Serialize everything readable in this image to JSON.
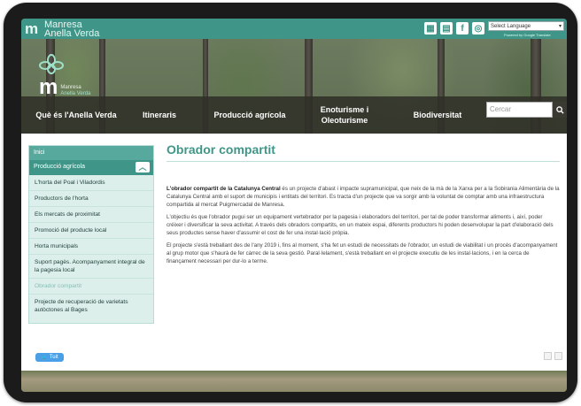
{
  "site": {
    "brand_line1": "Manresa",
    "brand_line2": "Anella Verda",
    "logo_text_line1": "Manresa",
    "logo_text_line2": "Anella Verda",
    "language_select": "Select Language",
    "language_powered": "Powered by Google Translate"
  },
  "top_icons": [
    "calculator-icon",
    "calendar-icon",
    "facebook-icon",
    "instagram-icon"
  ],
  "nav": {
    "items": [
      {
        "label": "Què és l'Anella Verda"
      },
      {
        "label": "Itineraris"
      },
      {
        "label": "Producció agrícola"
      },
      {
        "label": "Enoturisme i Oleoturisme"
      },
      {
        "label": "Biodiversitat"
      }
    ],
    "search_placeholder": "Cercar"
  },
  "sidebar": {
    "home": "Inici",
    "section": "Producció agrícola",
    "items": [
      {
        "label": "L'horta del Poal i Viladordis"
      },
      {
        "label": "Productors de l'horta"
      },
      {
        "label": "Els mercats de proximitat"
      },
      {
        "label": "Promoció del producte local"
      },
      {
        "label": "Horta municipals"
      },
      {
        "label": "Suport pagès. Acompanyament integral de la pagesia local"
      },
      {
        "label": "Obrador compartit",
        "active": true
      },
      {
        "label": "Projecte de recuperació de varietats autòctones al Bages"
      }
    ]
  },
  "article": {
    "title": "Obrador compartit",
    "p1_bold": "L'obrador compartit de la Catalunya Central",
    "p1_rest": " és un projecte d'abast i impacte supramunicipal, que neix de la mà de la Xarxa per a la Sobirania Alimentària de la Catalunya Central amb el suport de municipis i entitats del territori. Es tracta d'un projecte que va sorgir amb la voluntat de comptar amb una infraestructura compartida al mercat Puigmercadal de Manresa.",
    "p2": "L'objectiu és que l'obrador pugui ser un equipament vertebrador per la pagesia i elaboradors del territori, per tal de poder transformar aliments i, així, poder créixer i diversificar la seva activitat. A través dels obradors compartits, en un mateix espai, diferents productors hi poden desenvolupar la part d'elaboració dels seus productes sense haver d'assumir el cost de fer una instal·lació pròpia.",
    "p3": "El projecte s'està treballant des de l'any 2019 i, fins al moment, s'ha fet un estudi de necessitats de l'obrador, un estudi de viabilitat i un procés d'acompanyament al grup motor que s'haurà de fer càrrec de la seva gestió. Paral·lelament, s'està treballant en el projecte executiu de les instal·lacions, i en la cerca de finançament necessari per dur-lo a terme."
  },
  "share": {
    "tweet": "Tuit"
  },
  "colors": {
    "accent": "#3f9688",
    "accent_light": "#dcefeb",
    "nav_bg": "#2e2e28"
  }
}
